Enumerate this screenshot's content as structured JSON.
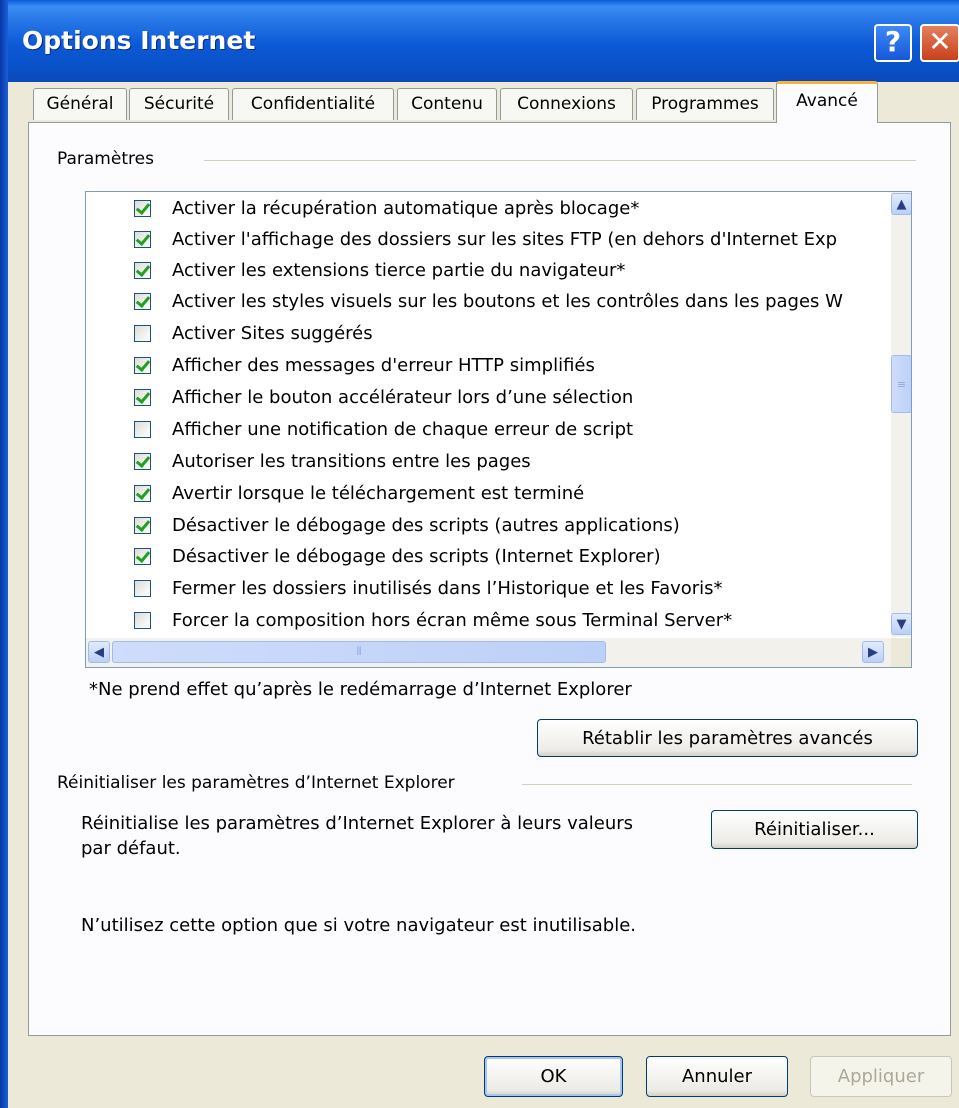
{
  "window": {
    "title": "Options Internet",
    "help_label": "?",
    "close_label": "✕"
  },
  "tabs": [
    {
      "label": "Général"
    },
    {
      "label": "Sécurité"
    },
    {
      "label": "Confidentialité"
    },
    {
      "label": "Contenu"
    },
    {
      "label": "Connexions"
    },
    {
      "label": "Programmes"
    },
    {
      "label": "Avancé",
      "active": true
    }
  ],
  "settings": {
    "heading": "Paramètres",
    "items": [
      {
        "label": "Activer la récupération automatique après blocage*",
        "checked": true
      },
      {
        "label": "Activer l'affichage des dossiers sur les sites FTP (en dehors d'Internet Exp",
        "checked": true
      },
      {
        "label": "Activer les extensions tierce partie du navigateur*",
        "checked": true
      },
      {
        "label": "Activer les styles visuels sur les boutons et les contrôles dans les pages W",
        "checked": true
      },
      {
        "label": "Activer Sites suggérés",
        "checked": false
      },
      {
        "label": "Afficher des messages d'erreur HTTP simplifiés",
        "checked": true
      },
      {
        "label": "Afficher le bouton accélérateur lors d’une sélection",
        "checked": true
      },
      {
        "label": "Afficher une notification de chaque erreur de script",
        "checked": false
      },
      {
        "label": "Autoriser les transitions entre les pages",
        "checked": true
      },
      {
        "label": "Avertir lorsque le téléchargement est terminé",
        "checked": true
      },
      {
        "label": "Désactiver le débogage des scripts (autres applications)",
        "checked": true
      },
      {
        "label": "Désactiver le débogage des scripts (Internet Explorer)",
        "checked": true
      },
      {
        "label": "Fermer les dossiers inutilisés dans l’Historique et les Favoris*",
        "checked": false
      },
      {
        "label": "Forcer la composition hors écran même sous Terminal Server*",
        "checked": false
      }
    ],
    "note": "*Ne prend effet qu’après le redémarrage d’Internet Explorer",
    "restore_button": "Rétablir les paramètres avancés"
  },
  "reset": {
    "heading": "Réinitialiser les paramètres d’Internet Explorer",
    "description_line1": "Réinitialise les paramètres d’Internet Explorer à leurs valeurs",
    "description_line2": "par défaut.",
    "button": "Réinitialiser...",
    "warning": "N’utilisez cette option que si votre navigateur est inutilisable."
  },
  "footer": {
    "ok": "OK",
    "cancel": "Annuler",
    "apply": "Appliquer"
  }
}
